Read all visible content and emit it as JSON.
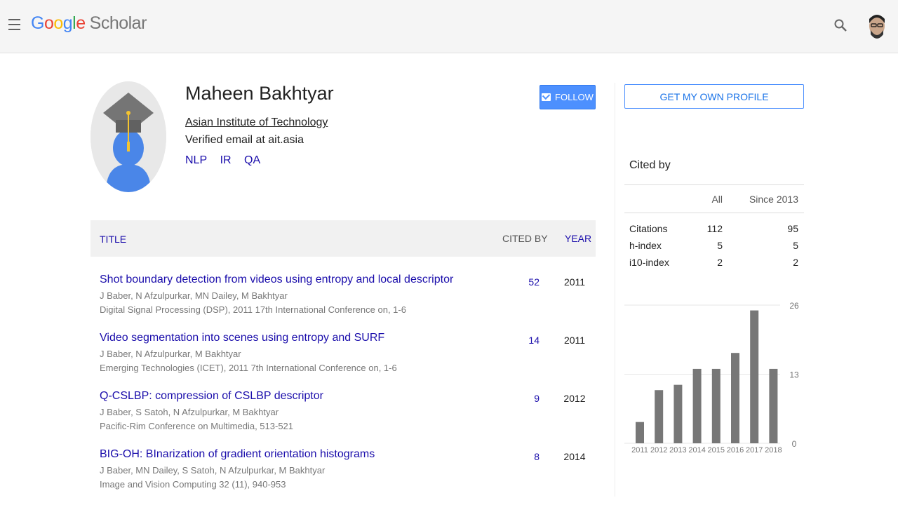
{
  "header": {
    "logo": {
      "google": "Google",
      "scholar": "Scholar"
    }
  },
  "profile": {
    "name": "Maheen Bakhtyar",
    "affiliation": "Asian Institute of Technology",
    "email": "Verified email at ait.asia",
    "interests": [
      "NLP",
      "IR",
      "QA"
    ],
    "follow_label": "FOLLOW"
  },
  "table": {
    "headers": {
      "title": "TITLE",
      "cited_by": "CITED BY",
      "year": "YEAR"
    },
    "rows": [
      {
        "title": "Shot boundary detection from videos using entropy and local descriptor",
        "authors": "J Baber, N Afzulpurkar, MN Dailey, M Bakhtyar",
        "venue": "Digital Signal Processing (DSP), 2011 17th International Conference on, 1-6",
        "cited_by": "52",
        "year": "2011"
      },
      {
        "title": "Video segmentation into scenes using entropy and SURF",
        "authors": "J Baber, N Afzulpurkar, M Bakhtyar",
        "venue": "Emerging Technologies (ICET), 2011 7th International Conference on, 1-6",
        "cited_by": "14",
        "year": "2011"
      },
      {
        "title": "Q-CSLBP: compression of CSLBP descriptor",
        "authors": "J Baber, S Satoh, N Afzulpurkar, M Bakhtyar",
        "venue": "Pacific-Rim Conference on Multimedia, 513-521",
        "cited_by": "9",
        "year": "2012"
      },
      {
        "title": "BIG-OH: BInarization of gradient orientation histograms",
        "authors": "J Baber, MN Dailey, S Satoh, N Afzulpurkar, M Bakhtyar",
        "venue": "Image and Vision Computing 32 (11), 940-953",
        "cited_by": "8",
        "year": "2014"
      }
    ]
  },
  "sidebar": {
    "own_profile_label": "GET MY OWN PROFILE",
    "cited_by_title": "Cited by",
    "col_all": "All",
    "col_since": "Since 2013",
    "metrics": [
      {
        "label": "Citations",
        "all": "112",
        "since": "95"
      },
      {
        "label": "h-index",
        "all": "5",
        "since": "5"
      },
      {
        "label": "i10-index",
        "all": "2",
        "since": "2"
      }
    ]
  },
  "chart_data": {
    "type": "bar",
    "categories": [
      "2011",
      "2012",
      "2013",
      "2014",
      "2015",
      "2016",
      "2017",
      "2018"
    ],
    "values": [
      4,
      10,
      11,
      14,
      14,
      17,
      25,
      14
    ],
    "ylim": [
      0,
      26
    ],
    "y_ticks": [
      "26",
      "13",
      "0"
    ],
    "grid": true,
    "bar_color": "#777777"
  },
  "colors": {
    "link": "#1a0dab",
    "accent": "#4d90fe"
  }
}
